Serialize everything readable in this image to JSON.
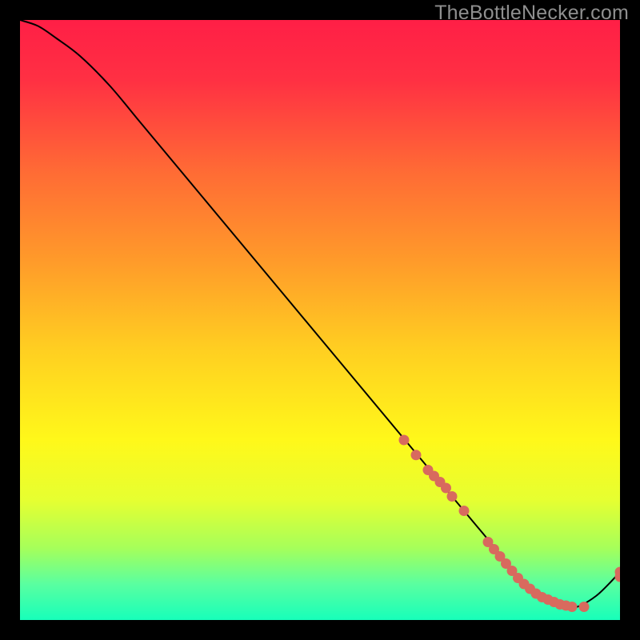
{
  "watermark": "TheBottleNecker.com",
  "chart_data": {
    "type": "line",
    "title": "",
    "xlabel": "",
    "ylabel": "",
    "xlim": [
      0,
      100
    ],
    "ylim": [
      0,
      100
    ],
    "grid": false,
    "series": [
      {
        "name": "bottleneck-curve",
        "x": [
          0,
          3,
          6,
          10,
          15,
          20,
          25,
          30,
          35,
          40,
          45,
          50,
          55,
          60,
          65,
          70,
          75,
          80,
          84,
          88,
          92,
          96,
          100
        ],
        "y": [
          100,
          99,
          97,
          94,
          89,
          83,
          77,
          71,
          65,
          59,
          53,
          47,
          41,
          35,
          29,
          23,
          17,
          11,
          6,
          3,
          2,
          4,
          8
        ]
      }
    ],
    "scatter": {
      "name": "data-points",
      "x": [
        64,
        66,
        68,
        69,
        70,
        71,
        72,
        74,
        78,
        79,
        80,
        81,
        82,
        83,
        84,
        85,
        86,
        87,
        88,
        89,
        90,
        91,
        92,
        94,
        100,
        100
      ],
      "y": [
        30,
        27.5,
        25,
        24,
        23,
        22,
        20.6,
        18.2,
        13,
        11.8,
        10.6,
        9.4,
        8.2,
        7.0,
        6.0,
        5.2,
        4.4,
        3.8,
        3.4,
        3.0,
        2.6,
        2.4,
        2.2,
        2.2,
        7.2,
        8.0
      ]
    },
    "gradient_stops": [
      {
        "offset": 0.0,
        "color": "#ff1f46"
      },
      {
        "offset": 0.1,
        "color": "#ff3043"
      },
      {
        "offset": 0.25,
        "color": "#ff6a35"
      },
      {
        "offset": 0.4,
        "color": "#ff9a2a"
      },
      {
        "offset": 0.55,
        "color": "#ffcf21"
      },
      {
        "offset": 0.7,
        "color": "#fff81a"
      },
      {
        "offset": 0.8,
        "color": "#e6ff31"
      },
      {
        "offset": 0.88,
        "color": "#a6ff5a"
      },
      {
        "offset": 0.94,
        "color": "#5affa0"
      },
      {
        "offset": 1.0,
        "color": "#17ffba"
      }
    ],
    "point_color": "#d86a5e",
    "line_color": "#000000"
  }
}
